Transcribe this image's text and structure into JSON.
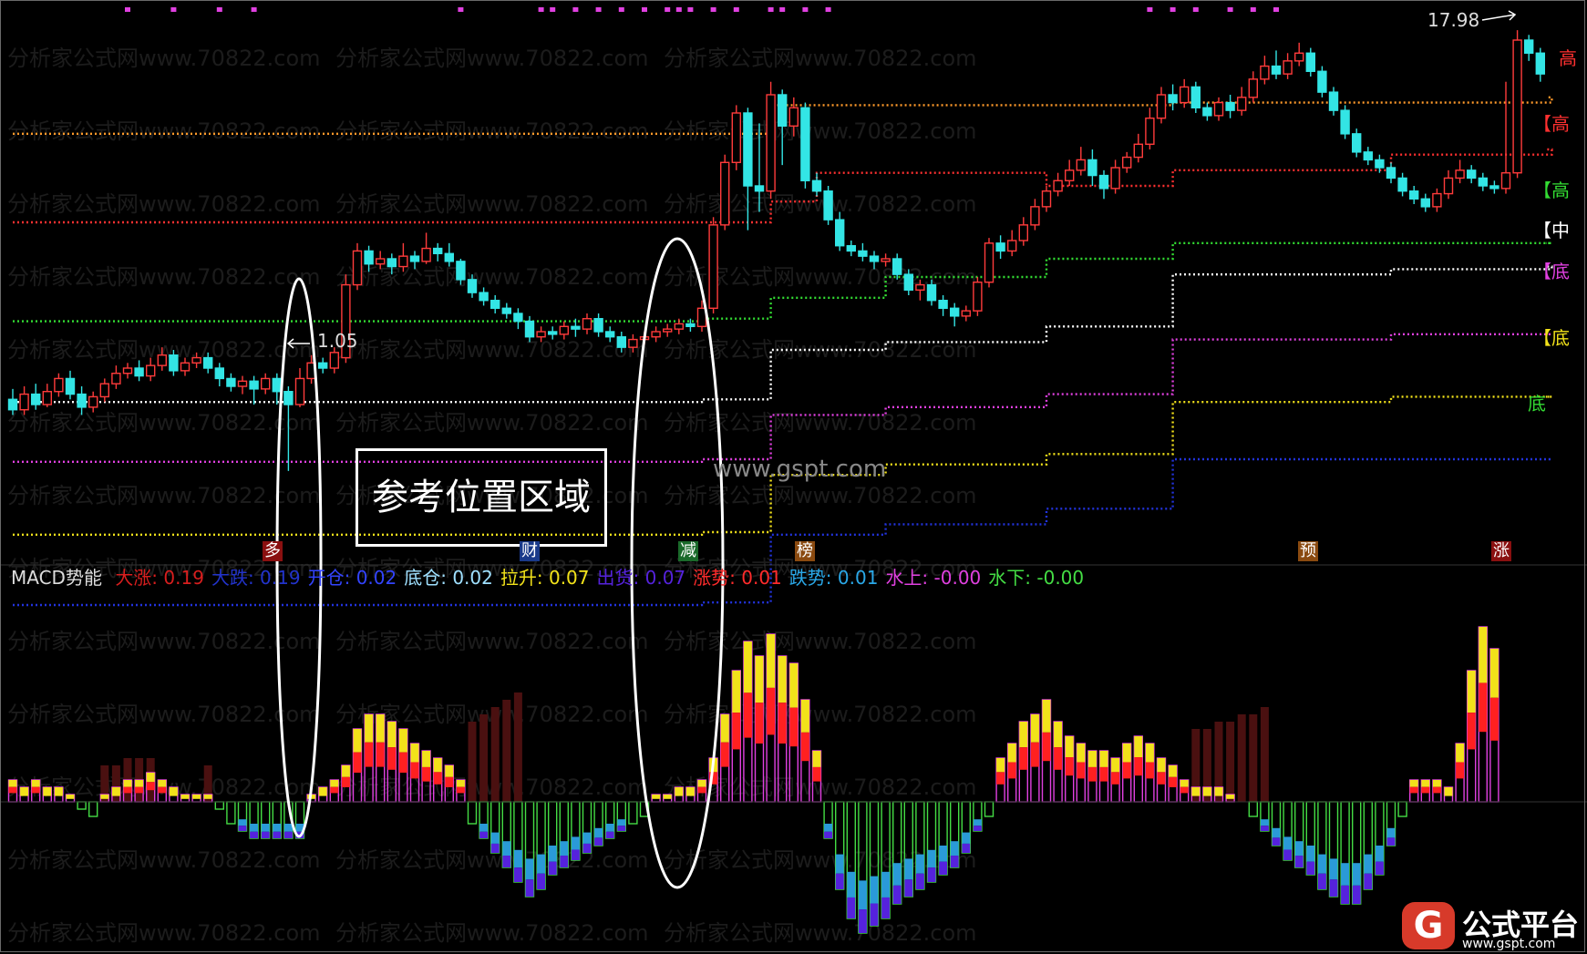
{
  "indicator": {
    "name": "MACD势能",
    "items": [
      {
        "label": "大涨:",
        "value": "0.19",
        "color": "#d81e1e"
      },
      {
        "label": "大跌:",
        "value": "0.19",
        "color": "#2233cc"
      },
      {
        "label": "开仓:",
        "value": "0.02",
        "color": "#3344ff"
      },
      {
        "label": "底仓:",
        "value": "0.02",
        "color": "#9fe0ff"
      },
      {
        "label": "拉升:",
        "value": "0.07",
        "color": "#f2e21a"
      },
      {
        "label": "出货:",
        "value": "0.07",
        "color": "#5522dd"
      },
      {
        "label": "涨势:",
        "value": "0.01",
        "color": "#ff2b2b"
      },
      {
        "label": "跌势:",
        "value": "0.01",
        "color": "#2aa8e8"
      },
      {
        "label": "水上:",
        "value": "-0.00",
        "color": "#e040e0"
      },
      {
        "label": "水下:",
        "value": "-0.00",
        "color": "#44dd44"
      }
    ]
  },
  "annotations": {
    "low_price": "1.05",
    "high_price": "17.98",
    "reference_box": "参考位置区域",
    "site_watermark": "www.gspt.com",
    "watermark_text": "分析家公式网www.70822.com"
  },
  "level_labels": [
    {
      "text": "高",
      "color": "#ff3030"
    },
    {
      "text": "【高",
      "color": "#ff3030"
    },
    {
      "text": "【高",
      "color": "#33dd33"
    },
    {
      "text": "【中",
      "color": "#ffffff"
    },
    {
      "text": "【底",
      "color": "#e040e0"
    },
    {
      "text": "【底",
      "color": "#f2e21a"
    },
    {
      "text": "底",
      "color": "#33dd33"
    }
  ],
  "signals": [
    {
      "text": "多",
      "bg": "#8a1010"
    },
    {
      "text": "财",
      "bg": "#1a3a8a"
    },
    {
      "text": "减",
      "bg": "#1a6a2a"
    },
    {
      "text": "榜",
      "bg": "#8a4a10"
    },
    {
      "text": "预",
      "bg": "#8a4a10"
    },
    {
      "text": "涨",
      "bg": "#8a1010"
    }
  ],
  "logo": {
    "mark": "G",
    "name": "公式平台",
    "url": "www.gspt.com"
  },
  "chart_data": {
    "type": "candlestick",
    "price_ylim": [
      -2,
      19
    ],
    "candles": [
      [
        3.8,
        3.4,
        4.2,
        3.2
      ],
      [
        3.4,
        4.0,
        4.3,
        3.2
      ],
      [
        4.0,
        3.6,
        4.4,
        3.4
      ],
      [
        3.6,
        4.1,
        4.4,
        3.5
      ],
      [
        4.1,
        4.6,
        4.8,
        3.9
      ],
      [
        4.6,
        4.0,
        4.9,
        3.8
      ],
      [
        4.0,
        3.5,
        4.3,
        3.2
      ],
      [
        3.5,
        3.9,
        4.1,
        3.3
      ],
      [
        3.9,
        4.4,
        4.6,
        3.7
      ],
      [
        4.4,
        4.8,
        5.1,
        4.2
      ],
      [
        4.8,
        5.0,
        5.2,
        4.6
      ],
      [
        5.0,
        4.7,
        5.3,
        4.5
      ],
      [
        4.7,
        5.1,
        5.4,
        4.5
      ],
      [
        5.1,
        5.5,
        5.8,
        4.9
      ],
      [
        5.5,
        4.9,
        5.7,
        4.7
      ],
      [
        4.9,
        5.2,
        5.4,
        4.7
      ],
      [
        5.2,
        5.4,
        5.6,
        5.0
      ],
      [
        5.4,
        5.0,
        5.6,
        4.8
      ],
      [
        5.0,
        4.6,
        5.2,
        4.3
      ],
      [
        4.6,
        4.3,
        4.8,
        4.1
      ],
      [
        4.3,
        4.5,
        4.7,
        4.0
      ],
      [
        4.5,
        4.2,
        4.7,
        3.6
      ],
      [
        4.2,
        4.6,
        4.8,
        4.0
      ],
      [
        4.6,
        4.1,
        4.8,
        3.6
      ],
      [
        4.1,
        3.6,
        4.3,
        1.05
      ],
      [
        3.6,
        4.6,
        5.0,
        3.5
      ],
      [
        4.6,
        5.2,
        5.5,
        4.4
      ],
      [
        5.2,
        5.0,
        5.4,
        4.8
      ],
      [
        5.0,
        5.6,
        5.8,
        4.8
      ],
      [
        5.4,
        8.2,
        8.6,
        5.2
      ],
      [
        8.2,
        9.5,
        9.8,
        8.0
      ],
      [
        9.5,
        9.0,
        9.7,
        8.7
      ],
      [
        9.0,
        9.2,
        9.5,
        8.8
      ],
      [
        9.2,
        8.9,
        9.4,
        8.6
      ],
      [
        8.9,
        9.3,
        9.8,
        8.7
      ],
      [
        9.3,
        9.1,
        9.5,
        8.8
      ],
      [
        9.1,
        9.6,
        10.2,
        9.0
      ],
      [
        9.6,
        9.4,
        9.8,
        9.1
      ],
      [
        9.4,
        9.1,
        9.8,
        8.9
      ],
      [
        9.1,
        8.4,
        9.2,
        8.2
      ],
      [
        8.4,
        7.9,
        8.6,
        7.7
      ],
      [
        7.9,
        7.6,
        8.1,
        7.4
      ],
      [
        7.6,
        7.3,
        7.8,
        7.1
      ],
      [
        7.3,
        7.1,
        7.5,
        6.9
      ],
      [
        7.1,
        6.8,
        7.3,
        6.5
      ],
      [
        6.8,
        6.2,
        7.0,
        6.0
      ],
      [
        6.2,
        6.4,
        6.6,
        6.0
      ],
      [
        6.4,
        6.3,
        6.6,
        6.1
      ],
      [
        6.3,
        6.6,
        6.8,
        6.1
      ],
      [
        6.6,
        6.5,
        6.9,
        6.2
      ],
      [
        6.5,
        6.9,
        7.1,
        6.3
      ],
      [
        6.9,
        6.4,
        7.1,
        6.2
      ],
      [
        6.4,
        6.2,
        6.6,
        6.0
      ],
      [
        6.2,
        5.8,
        6.4,
        5.6
      ],
      [
        5.8,
        6.1,
        6.3,
        5.6
      ],
      [
        6.1,
        6.2,
        6.4,
        5.9
      ],
      [
        6.2,
        6.4,
        6.6,
        6.0
      ],
      [
        6.4,
        6.5,
        6.7,
        6.2
      ],
      [
        6.5,
        6.7,
        6.9,
        6.3
      ],
      [
        6.7,
        6.6,
        6.9,
        6.4
      ],
      [
        6.6,
        7.3,
        7.6,
        6.4
      ],
      [
        7.3,
        10.5,
        10.8,
        7.1
      ],
      [
        10.5,
        12.9,
        13.2,
        10.3
      ],
      [
        12.9,
        14.8,
        15.1,
        12.6
      ],
      [
        14.8,
        12.0,
        15.0,
        10.3
      ],
      [
        12.0,
        11.8,
        14.4,
        11.0
      ],
      [
        11.8,
        15.5,
        16.0,
        11.5
      ],
      [
        15.5,
        14.3,
        15.7,
        12.8
      ],
      [
        14.3,
        15.0,
        15.4,
        13.9
      ],
      [
        15.0,
        12.2,
        15.2,
        11.9
      ],
      [
        12.2,
        11.8,
        12.5,
        11.6
      ],
      [
        11.8,
        10.7,
        12.0,
        10.5
      ],
      [
        10.7,
        9.7,
        11.0,
        9.5
      ],
      [
        9.7,
        9.5,
        9.9,
        9.3
      ],
      [
        9.5,
        9.3,
        9.8,
        9.1
      ],
      [
        9.3,
        9.1,
        9.5,
        8.8
      ],
      [
        9.1,
        9.2,
        9.4,
        8.9
      ],
      [
        9.2,
        8.6,
        9.4,
        8.4
      ],
      [
        8.6,
        8.0,
        8.8,
        7.8
      ],
      [
        8.0,
        8.2,
        8.4,
        7.6
      ],
      [
        8.2,
        7.6,
        8.4,
        7.4
      ],
      [
        7.6,
        7.3,
        7.8,
        7.0
      ],
      [
        7.3,
        7.0,
        7.5,
        6.6
      ],
      [
        7.0,
        7.2,
        7.4,
        6.8
      ],
      [
        7.2,
        8.3,
        8.5,
        7.0
      ],
      [
        8.3,
        9.8,
        10.0,
        8.1
      ],
      [
        9.8,
        9.5,
        10.1,
        9.2
      ],
      [
        9.5,
        9.9,
        10.3,
        9.3
      ],
      [
        9.9,
        10.5,
        10.8,
        9.7
      ],
      [
        10.5,
        11.2,
        11.5,
        10.3
      ],
      [
        11.2,
        11.8,
        12.0,
        11.0
      ],
      [
        11.8,
        12.2,
        12.5,
        11.6
      ],
      [
        12.2,
        12.6,
        13.0,
        12.0
      ],
      [
        12.6,
        13.0,
        13.5,
        12.4
      ],
      [
        13.0,
        12.4,
        13.4,
        12.0
      ],
      [
        12.4,
        11.9,
        12.6,
        11.5
      ],
      [
        11.9,
        12.7,
        13.0,
        11.7
      ],
      [
        12.7,
        13.1,
        13.3,
        12.5
      ],
      [
        13.1,
        13.6,
        14.0,
        12.9
      ],
      [
        13.6,
        14.6,
        15.0,
        13.4
      ],
      [
        14.6,
        15.5,
        15.8,
        14.4
      ],
      [
        15.5,
        15.2,
        15.9,
        14.9
      ],
      [
        15.2,
        15.8,
        16.1,
        15.0
      ],
      [
        15.8,
        15.0,
        16.0,
        14.8
      ],
      [
        15.0,
        14.7,
        15.2,
        14.5
      ],
      [
        14.7,
        15.2,
        15.4,
        14.5
      ],
      [
        15.2,
        14.9,
        15.5,
        14.6
      ],
      [
        14.9,
        15.4,
        15.8,
        14.7
      ],
      [
        15.4,
        16.1,
        16.4,
        15.2
      ],
      [
        16.1,
        16.6,
        17.0,
        15.9
      ],
      [
        16.6,
        16.3,
        17.2,
        16.1
      ],
      [
        16.3,
        16.8,
        17.1,
        16.1
      ],
      [
        16.8,
        17.1,
        17.5,
        16.6
      ],
      [
        17.1,
        16.4,
        17.3,
        16.2
      ],
      [
        16.4,
        15.6,
        16.6,
        15.4
      ],
      [
        15.6,
        14.9,
        15.8,
        14.7
      ],
      [
        14.9,
        14.0,
        15.1,
        13.8
      ],
      [
        14.0,
        13.3,
        14.2,
        13.1
      ],
      [
        13.3,
        13.0,
        13.5,
        12.8
      ],
      [
        13.0,
        12.7,
        13.2,
        12.5
      ],
      [
        12.7,
        12.3,
        12.9,
        12.1
      ],
      [
        12.3,
        11.8,
        12.5,
        11.6
      ],
      [
        11.8,
        11.5,
        12.0,
        11.3
      ],
      [
        11.5,
        11.2,
        11.7,
        11.0
      ],
      [
        11.2,
        11.7,
        11.9,
        11.0
      ],
      [
        11.7,
        12.3,
        12.6,
        11.5
      ],
      [
        12.3,
        12.6,
        13.0,
        12.1
      ],
      [
        12.6,
        12.3,
        12.8,
        12.1
      ],
      [
        12.3,
        12.0,
        12.5,
        11.8
      ],
      [
        12.0,
        11.9,
        12.2,
        11.7
      ],
      [
        11.9,
        12.5,
        16.0,
        11.7
      ],
      [
        12.5,
        17.6,
        17.98,
        12.3
      ],
      [
        17.6,
        17.1,
        17.8,
        16.8
      ],
      [
        17.1,
        16.3,
        17.3,
        16.0
      ]
    ],
    "level_lines": [
      {
        "name": "高",
        "color": "#ff9a2a",
        "steps": [
          [
            0,
            14.0
          ],
          [
            62,
            14.0
          ],
          [
            66,
            15.1
          ],
          [
            75,
            15.1
          ],
          [
            101,
            15.2
          ],
          [
            134,
            15.4
          ]
        ]
      },
      {
        "name": "高2",
        "color": "#ff3030",
        "steps": [
          [
            0,
            10.6
          ],
          [
            60,
            10.6
          ],
          [
            66,
            11.4
          ],
          [
            70,
            12.5
          ],
          [
            90,
            12.0
          ],
          [
            101,
            12.6
          ],
          [
            120,
            13.2
          ],
          [
            134,
            13.4
          ]
        ]
      },
      {
        "name": "高3",
        "color": "#33dd33",
        "steps": [
          [
            0,
            6.8
          ],
          [
            60,
            6.9
          ],
          [
            66,
            7.7
          ],
          [
            76,
            8.5
          ],
          [
            90,
            9.2
          ],
          [
            101,
            9.8
          ],
          [
            134,
            9.8
          ]
        ]
      },
      {
        "name": "中",
        "color": "#ffffff",
        "steps": [
          [
            0,
            3.7
          ],
          [
            60,
            3.8
          ],
          [
            66,
            5.7
          ],
          [
            76,
            6.0
          ],
          [
            90,
            6.6
          ],
          [
            101,
            8.6
          ],
          [
            120,
            8.8
          ],
          [
            134,
            8.9
          ]
        ]
      },
      {
        "name": "底2",
        "color": "#e040e0",
        "steps": [
          [
            0,
            1.4
          ],
          [
            60,
            1.5
          ],
          [
            66,
            3.2
          ],
          [
            76,
            3.5
          ],
          [
            90,
            4.0
          ],
          [
            101,
            6.1
          ],
          [
            120,
            6.3
          ],
          [
            134,
            6.3
          ]
        ]
      },
      {
        "name": "底1",
        "color": "#f2e21a",
        "steps": [
          [
            0,
            -1.4
          ],
          [
            60,
            -1.3
          ],
          [
            66,
            0.9
          ],
          [
            76,
            1.3
          ],
          [
            90,
            1.7
          ],
          [
            101,
            3.7
          ],
          [
            120,
            3.9
          ],
          [
            134,
            3.9
          ]
        ]
      },
      {
        "name": "底",
        "color": "#2233dd",
        "steps": [
          [
            0,
            -4.1
          ],
          [
            60,
            -4.0
          ],
          [
            66,
            -1.4
          ],
          [
            76,
            -1.0
          ],
          [
            90,
            -0.4
          ],
          [
            101,
            1.5
          ],
          [
            134,
            1.5
          ]
        ]
      }
    ],
    "macd_ylim": [
      -0.2,
      0.3
    ],
    "macd": [
      0.03,
      0.02,
      0.03,
      0.02,
      0.02,
      0.01,
      -0.01,
      -0.02,
      0.01,
      0.02,
      0.03,
      0.03,
      0.04,
      0.03,
      0.02,
      0.01,
      0.01,
      0.01,
      -0.01,
      -0.03,
      -0.04,
      -0.05,
      -0.05,
      -0.05,
      -0.05,
      -0.05,
      0.01,
      0.02,
      0.03,
      0.05,
      0.1,
      0.12,
      0.12,
      0.11,
      0.1,
      0.08,
      0.07,
      0.06,
      0.05,
      0.03,
      -0.03,
      -0.05,
      -0.07,
      -0.09,
      -0.11,
      -0.13,
      -0.12,
      -0.1,
      -0.09,
      -0.08,
      -0.07,
      -0.06,
      -0.05,
      -0.04,
      -0.03,
      -0.02,
      0.01,
      0.01,
      0.02,
      0.02,
      0.03,
      0.06,
      0.12,
      0.18,
      0.22,
      0.2,
      0.23,
      0.2,
      0.19,
      0.14,
      0.07,
      -0.05,
      -0.12,
      -0.16,
      -0.18,
      -0.17,
      -0.16,
      -0.14,
      -0.13,
      -0.12,
      -0.11,
      -0.1,
      -0.09,
      -0.07,
      -0.04,
      -0.02,
      0.06,
      0.08,
      0.11,
      0.12,
      0.14,
      0.11,
      0.09,
      0.08,
      0.07,
      0.07,
      0.06,
      0.08,
      0.09,
      0.08,
      0.06,
      0.05,
      0.03,
      0.02,
      0.02,
      0.02,
      0.01,
      0.0,
      -0.02,
      -0.04,
      -0.06,
      -0.08,
      -0.09,
      -0.1,
      -0.12,
      -0.13,
      -0.14,
      -0.14,
      -0.12,
      -0.1,
      -0.06,
      -0.02,
      0.03,
      0.03,
      0.03,
      0.02,
      0.08,
      0.18,
      0.24,
      0.21
    ],
    "macd_shadow": [
      [
        8,
        0.05
      ],
      [
        9,
        0.05
      ],
      [
        10,
        0.06
      ],
      [
        11,
        0.06
      ],
      [
        12,
        0.06
      ],
      [
        17,
        0.05
      ],
      [
        40,
        0.11
      ],
      [
        41,
        0.12
      ],
      [
        42,
        0.13
      ],
      [
        43,
        0.14
      ],
      [
        44,
        0.15
      ],
      [
        103,
        0.1
      ],
      [
        104,
        0.1
      ],
      [
        105,
        0.11
      ],
      [
        106,
        0.11
      ],
      [
        107,
        0.12
      ],
      [
        108,
        0.12
      ],
      [
        109,
        0.13
      ]
    ]
  }
}
